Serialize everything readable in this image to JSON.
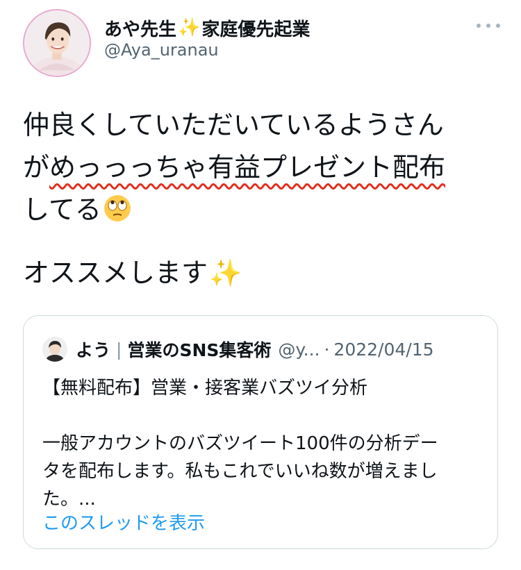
{
  "author": {
    "display_name": "あや先生",
    "name_suffix": "家庭優先起業",
    "sparkle_emoji": "✨",
    "handle": "@Aya_uranau"
  },
  "tweet": {
    "line1": "仲良くしていただいているようさん",
    "line2_plain": "が",
    "line2_underlined": "めっっっちゃ有益プレゼント配布",
    "line3": "してる",
    "line3_emoji": "🙄",
    "line4": "オススメします",
    "line4_emoji": "✨"
  },
  "quoted": {
    "name": "よう",
    "name_separator": "|",
    "name_suffix": "営業のSNS集客術",
    "handle": "@y...",
    "dot": "·",
    "date": "2022/04/15",
    "title": "【無料配布】営業・接客業バズツイ分析",
    "body_line1": "一般アカウントのバズツイート100件の分析デー",
    "body_line2": "タを配布します。私もこれでいいね数が増えまし",
    "body_line3": "た。...",
    "thread_link": "このスレッドを表示"
  },
  "colors": {
    "link": "#1d9bf0",
    "secondary_text": "#536471",
    "underline": "#e0301e",
    "avatar_ring": "#e9a8cf"
  },
  "icons": {
    "more": "more-horizontal-icon",
    "sparkle": "sparkle-icon",
    "eye_roll": "face-with-rolling-eyes-icon"
  }
}
